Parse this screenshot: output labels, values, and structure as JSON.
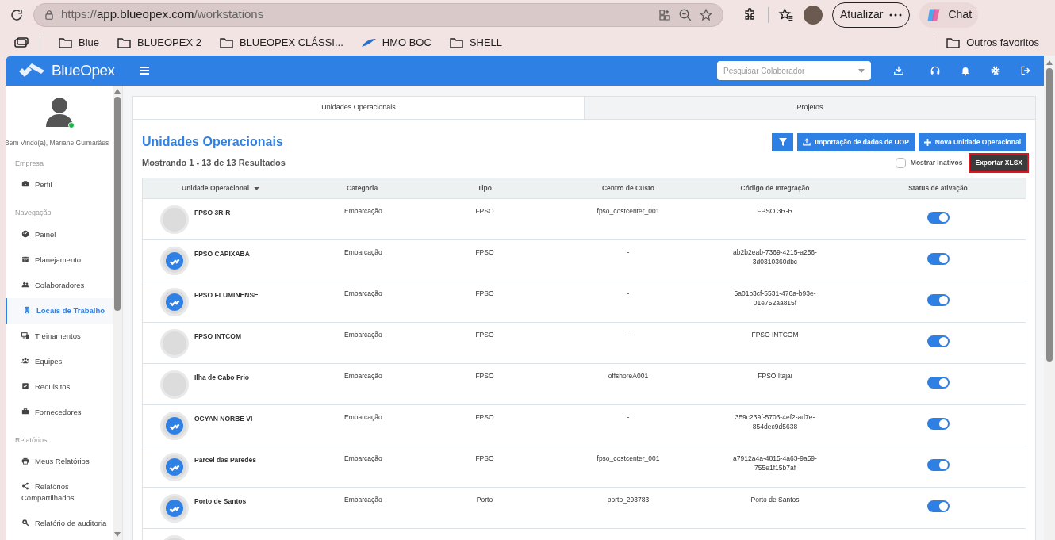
{
  "browser": {
    "url_scheme": "https://",
    "url_host": "app.blueopex.com",
    "url_path": "/workstations",
    "update_button": "Atualizar",
    "chat_button": "Chat",
    "bookmarks": [
      {
        "label": "Blue",
        "kind": "folder"
      },
      {
        "label": "BLUEOPEX 2",
        "kind": "folder"
      },
      {
        "label": "BLUEOPEX CLÁSSI...",
        "kind": "folder"
      },
      {
        "label": "HMO BOC",
        "kind": "site"
      },
      {
        "label": "SHELL",
        "kind": "folder"
      }
    ],
    "other_bookmarks": "Outros favoritos"
  },
  "app": {
    "logo": "BlueOpex",
    "search": {
      "placeholder": "Pesquisar Colaborador"
    }
  },
  "sidebar": {
    "welcome": "Bem Vindo(a), Mariane Guimarães",
    "online": true,
    "sections": [
      {
        "title": "Empresa",
        "items": [
          {
            "label": "Perfil",
            "kind": "briefcase",
            "selected": false
          }
        ]
      },
      {
        "title": "Navegação",
        "items": [
          {
            "label": "Painel",
            "kind": "gauge",
            "selected": false
          },
          {
            "label": "Planejamento",
            "kind": "calendar",
            "selected": false
          },
          {
            "label": "Colaboradores",
            "kind": "users",
            "selected": false
          },
          {
            "label": "Locais de Trabalho",
            "kind": "building",
            "selected": true
          },
          {
            "label": "Treinamentos",
            "kind": "devices",
            "selected": false
          },
          {
            "label": "Equipes",
            "kind": "group",
            "selected": false
          },
          {
            "label": "Requisitos",
            "kind": "check",
            "selected": false
          },
          {
            "label": "Fornecedores",
            "kind": "briefcase",
            "selected": false
          }
        ]
      },
      {
        "title": "Relatórios",
        "items": [
          {
            "label": "Meus Relatórios",
            "kind": "printer",
            "selected": false
          },
          {
            "label": "Relatórios Compartilhados",
            "kind": "share",
            "selected": false
          },
          {
            "label": "Relatório de auditoria",
            "kind": "search",
            "selected": false
          }
        ]
      }
    ]
  },
  "tabs": [
    {
      "label": "Unidades Operacionais",
      "selected": true
    },
    {
      "label": "Projetos",
      "selected": false
    }
  ],
  "title": "Unidades Operacionais",
  "results": "Mostrando 1 - 13 de 13 Resultados",
  "actions": {
    "import": "Importação de dados de UOP",
    "new": "Nova Unidade Operacional",
    "show_inactive": {
      "label": "Mostrar Inativos",
      "checked": false
    },
    "export": {
      "label": "Exportar XLSX",
      "highlighted": true
    }
  },
  "table": {
    "columns": [
      {
        "label": "Unidade Operacional",
        "sorted": true
      },
      {
        "label": "Categoria",
        "sorted": false
      },
      {
        "label": "Tipo",
        "sorted": false
      },
      {
        "label": "Centro de Custo",
        "sorted": false
      },
      {
        "label": "Código de Integração",
        "sorted": false
      },
      {
        "label": "Status de ativação",
        "sorted": false
      }
    ],
    "rows": [
      {
        "name": "FPSO 3R-R",
        "logo": false,
        "category": "Embarcação",
        "type": "FPSO",
        "cost_center": "fpso_costcenter_001",
        "integration_code": "FPSO 3R-R",
        "active": true
      },
      {
        "name": "FPSO CAPIXABA",
        "logo": true,
        "category": "Embarcação",
        "type": "FPSO",
        "cost_center": "-",
        "integration_code": "ab2b2eab-7369-4215-a256-3d0310360dbc",
        "active": true
      },
      {
        "name": "FPSO FLUMINENSE",
        "logo": true,
        "category": "Embarcação",
        "type": "FPSO",
        "cost_center": "-",
        "integration_code": "5a01b3cf-5531-476a-b93e-01e752aa815f",
        "active": true
      },
      {
        "name": "FPSO INTCOM",
        "logo": false,
        "category": "Embarcação",
        "type": "FPSO",
        "cost_center": "-",
        "integration_code": "FPSO INTCOM",
        "active": true
      },
      {
        "name": "Ilha de Cabo Frio",
        "logo": false,
        "category": "Embarcação",
        "type": "FPSO",
        "cost_center": "offshoreA001",
        "integration_code": "FPSO Itajai",
        "active": true
      },
      {
        "name": "OCYAN NORBE VI",
        "logo": true,
        "category": "Embarcação",
        "type": "FPSO",
        "cost_center": "-",
        "integration_code": "359c239f-5703-4ef2-ad7e-854dec9d5638",
        "active": true
      },
      {
        "name": "Parcel das Paredes",
        "logo": true,
        "category": "Embarcação",
        "type": "FPSO",
        "cost_center": "fpso_costcenter_001",
        "integration_code": "a7912a4a-4815-4a63-9a59-755e1f15b7af",
        "active": true
      },
      {
        "name": "Porto de Santos",
        "logo": true,
        "category": "Embarcação",
        "type": "Porto",
        "cost_center": "porto_293783",
        "integration_code": "Porto de Santos",
        "active": true
      }
    ]
  }
}
